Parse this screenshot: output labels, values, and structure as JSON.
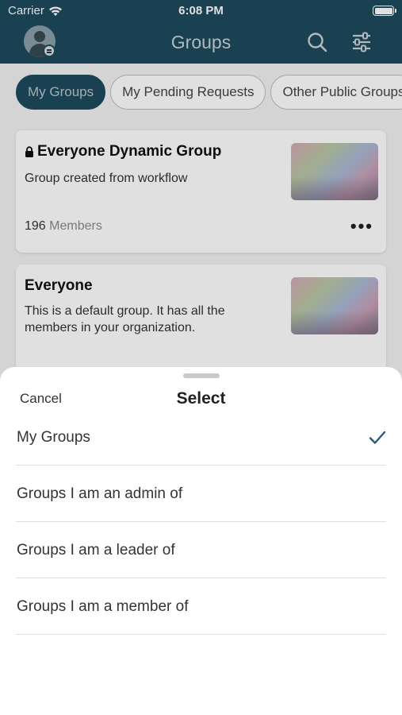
{
  "status_bar": {
    "carrier": "Carrier",
    "time": "6:08 PM"
  },
  "navbar": {
    "title": "Groups",
    "icons": [
      "avatar",
      "search-icon",
      "filter-icon"
    ]
  },
  "tabs": [
    {
      "label": "My Groups",
      "active": true
    },
    {
      "label": "My Pending Requests",
      "active": false
    },
    {
      "label": "Other Public Groups",
      "active": false
    }
  ],
  "cards": [
    {
      "title": "Everyone Dynamic Group",
      "locked": true,
      "description": "Group created from workflow",
      "member_count": "196",
      "member_label": "Members",
      "more": "•••"
    },
    {
      "title": "Everyone",
      "locked": false,
      "description": "This is a default group. It has all the members in your organization."
    }
  ],
  "sheet": {
    "cancel_label": "Cancel",
    "title": "Select",
    "options": [
      {
        "label": "My Groups",
        "selected": true
      },
      {
        "label": "Groups I am an admin of",
        "selected": false
      },
      {
        "label": "Groups I am a leader of",
        "selected": false
      },
      {
        "label": "Groups I am a member of",
        "selected": false
      }
    ]
  },
  "colors": {
    "brand": "#1d4b5e",
    "check": "#2d5a70"
  }
}
